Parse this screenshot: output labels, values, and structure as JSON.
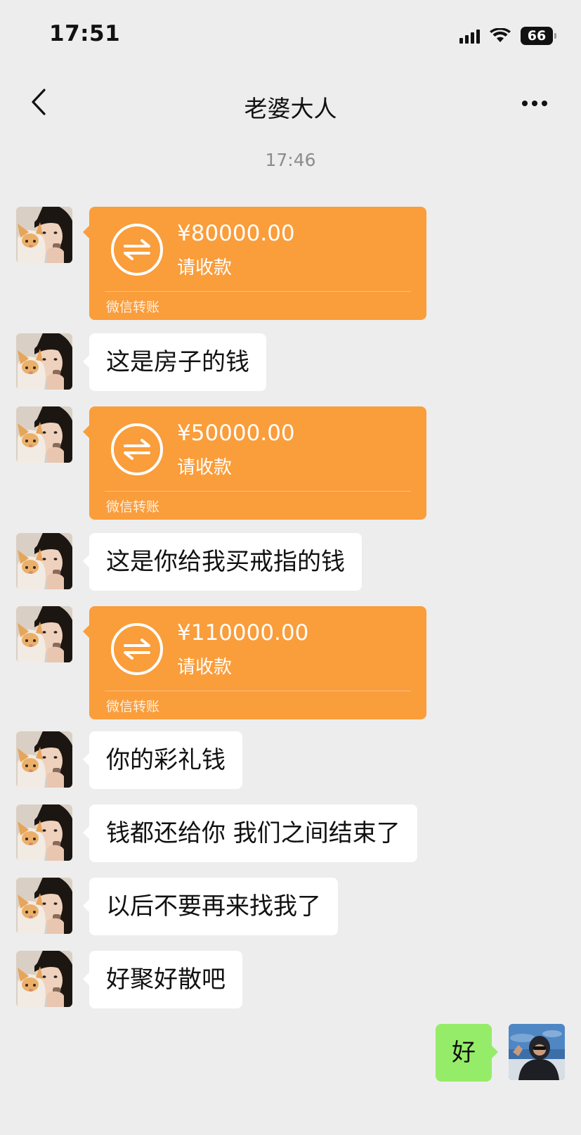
{
  "status_bar": {
    "time": "17:51",
    "battery": "66"
  },
  "nav": {
    "title": "老婆大人"
  },
  "timestamp": "17:46",
  "messages": [
    {
      "type": "transfer",
      "amount": "¥80000.00",
      "status": "请收款",
      "label": "微信转账"
    },
    {
      "type": "text",
      "text": "这是房子的钱"
    },
    {
      "type": "transfer",
      "amount": "¥50000.00",
      "status": "请收款",
      "label": "微信转账"
    },
    {
      "type": "text",
      "text": "这是你给我买戒指的钱"
    },
    {
      "type": "transfer",
      "amount": "¥110000.00",
      "status": "请收款",
      "label": "微信转账"
    },
    {
      "type": "text",
      "text": "你的彩礼钱"
    },
    {
      "type": "text",
      "text": "钱都还给你 我们之间结束了"
    },
    {
      "type": "text",
      "text": "以后不要再来找我了"
    },
    {
      "type": "text",
      "text": "好聚好散吧"
    },
    {
      "type": "text_self",
      "text": "好"
    }
  ],
  "colors": {
    "background": "#ededed",
    "transfer_orange": "#fa9d3b",
    "self_bubble_green": "#95ec69",
    "other_bubble": "#ffffff"
  },
  "icons": {
    "back": "chevron-left-icon",
    "more": "more-dots-icon",
    "transfer": "transfer-arrows-icon",
    "signal": "signal-icon",
    "wifi": "wifi-icon",
    "battery": "battery-icon"
  }
}
